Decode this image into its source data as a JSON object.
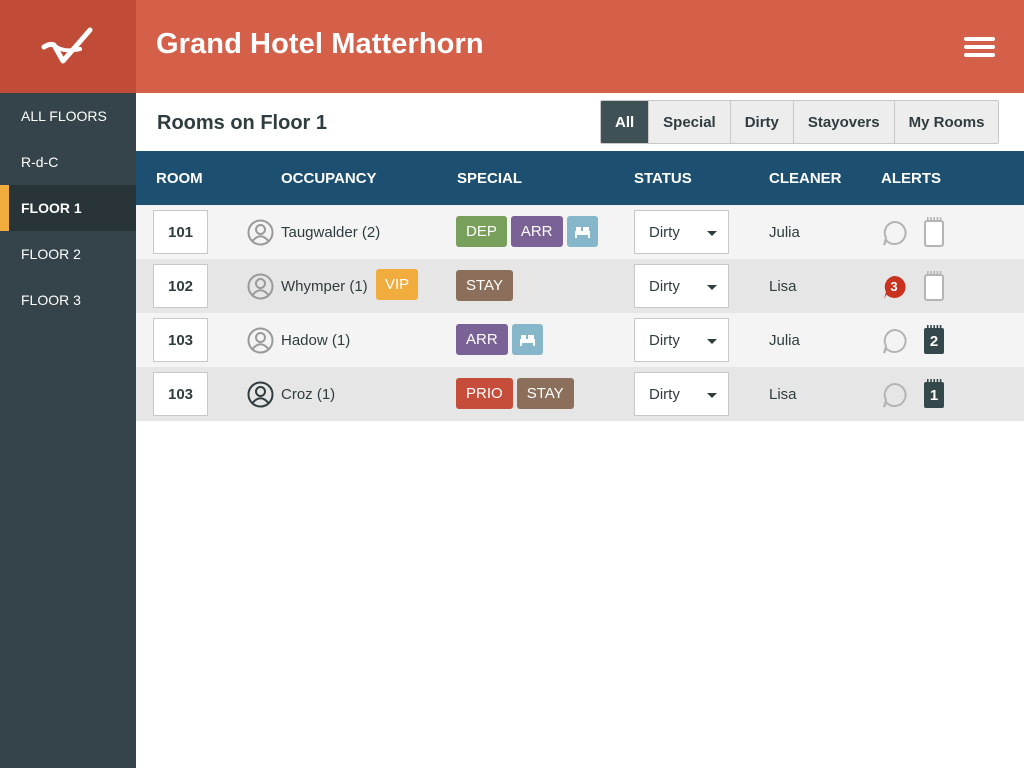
{
  "app": {
    "title": "Grand Hotel Matterhorn"
  },
  "sidebar": {
    "items": [
      {
        "label": "ALL FLOORS",
        "active": false
      },
      {
        "label": "R-d-C",
        "active": false
      },
      {
        "label": "FLOOR 1",
        "active": true
      },
      {
        "label": "FLOOR 2",
        "active": false
      },
      {
        "label": "FLOOR 3",
        "active": false
      }
    ]
  },
  "subheader": {
    "title": "Rooms on Floor 1",
    "filters": [
      {
        "label": "All",
        "active": true
      },
      {
        "label": "Special",
        "active": false
      },
      {
        "label": "Dirty",
        "active": false
      },
      {
        "label": "Stayovers",
        "active": false
      },
      {
        "label": "My Rooms",
        "active": false
      }
    ]
  },
  "table": {
    "headers": [
      "ROOM",
      "OCCUPANCY",
      "SPECIAL",
      "STATUS",
      "CLEANER",
      "ALERTS"
    ],
    "rows": [
      {
        "room": "101",
        "guest": "Taugwalder (2)",
        "guest_icon": "person-outline-icon",
        "vip": "",
        "tags": [
          {
            "label": "DEP",
            "color": "#79a05a"
          },
          {
            "label": "ARR",
            "color": "#7a6196"
          },
          {
            "label": "",
            "icon": "bed-icon",
            "color": "#86b6c9"
          }
        ],
        "status": "Dirty",
        "cleaner": "Julia",
        "messages": "",
        "note_count": ""
      },
      {
        "room": "102",
        "guest": "Whymper (1)",
        "guest_icon": "person-outline-icon",
        "vip": "VIP",
        "tags": [
          {
            "label": "STAY",
            "color": "#8b6f5a"
          }
        ],
        "status": "Dirty",
        "cleaner": "Lisa",
        "messages": "3",
        "note_count": ""
      },
      {
        "room": "103",
        "guest": "Hadow (1)",
        "guest_icon": "person-outline-icon",
        "vip": "",
        "tags": [
          {
            "label": "ARR",
            "color": "#7a6196"
          },
          {
            "label": "",
            "icon": "bed-icon",
            "color": "#86b6c9"
          }
        ],
        "status": "Dirty",
        "cleaner": "Julia",
        "messages": "",
        "note_count": "2"
      },
      {
        "room": "103",
        "guest": "Croz (1)",
        "guest_icon": "person-dark-icon",
        "vip": "",
        "tags": [
          {
            "label": "PRIO",
            "color": "#c64d3a"
          },
          {
            "label": "STAY",
            "color": "#8b6f5a"
          }
        ],
        "status": "Dirty",
        "cleaner": "Lisa",
        "messages": "",
        "note_count": "1"
      }
    ]
  },
  "colors": {
    "header": "#d5604a",
    "logo_bg": "#c04c37",
    "sidebar": "#34444a",
    "active_marker": "#f0ad3e",
    "table_header": "#1d5070",
    "message_badge": "#c8321f",
    "note_filled": "#34484c"
  }
}
